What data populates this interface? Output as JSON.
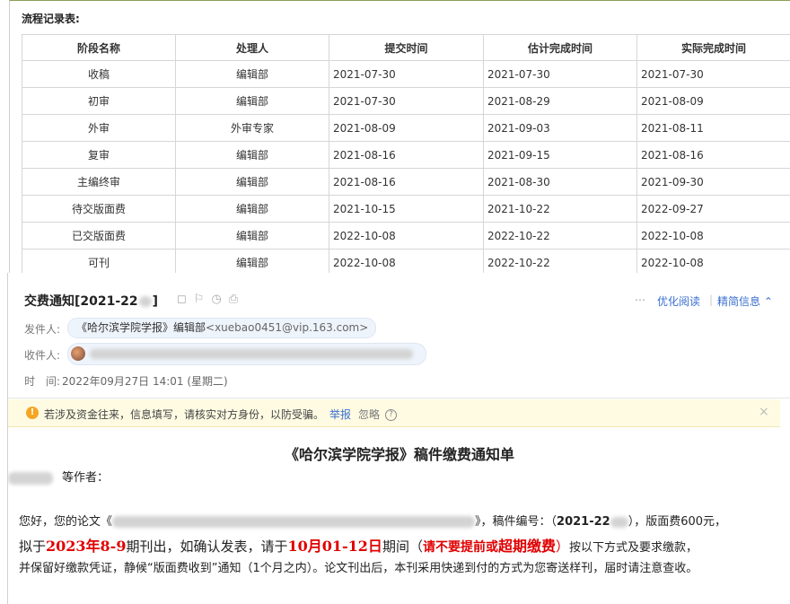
{
  "flow_record": {
    "title": "流程记录表:",
    "headers": [
      "阶段名称",
      "处理人",
      "提交时间",
      "估计完成时间",
      "实际完成时间"
    ],
    "rows": [
      [
        "收稿",
        "编辑部",
        "2021-07-30",
        "2021-07-30",
        "2021-07-30"
      ],
      [
        "初审",
        "编辑部",
        "2021-07-30",
        "2021-08-29",
        "2021-08-09"
      ],
      [
        "外审",
        "外审专家",
        "2021-08-09",
        "2021-09-03",
        "2021-08-11"
      ],
      [
        "复审",
        "编辑部",
        "2021-08-16",
        "2021-09-15",
        "2021-08-16"
      ],
      [
        "主编终审",
        "编辑部",
        "2021-08-16",
        "2021-08-30",
        "2021-09-30"
      ],
      [
        "待交版面费",
        "编辑部",
        "2021-10-15",
        "2021-10-22",
        "2022-09-27"
      ],
      [
        "已交版面费",
        "编辑部",
        "2022-10-08",
        "2022-10-22",
        "2022-10-08"
      ],
      [
        "可刊",
        "编辑部",
        "2022-10-08",
        "2022-10-22",
        "2022-10-08"
      ]
    ]
  },
  "email": {
    "subject_prefix": "交费通知[2021-22",
    "subject_suffix": "]",
    "optimize_read": "优化阅读",
    "simplified": "精简信息",
    "sender_label": "发件人:",
    "sender_name": "《哈尔滨学院学报》编辑部",
    "sender_addr": "<xuebao0451@vip.163.com>",
    "recipient_label": "收件人:",
    "time_label": "时　间:",
    "time_value": "2022年09月27日 14:01 (星期二)",
    "warning": "若涉及资金往来，信息填写，请核实对方身份，以防受骗。",
    "report": "举报",
    "ignore": "忽略",
    "doc_title": "《哈尔滨学院学报》稿件缴费通知单",
    "authors_suffix": "等作者：",
    "line1_a": "您好，您的论文《",
    "line1_b": "》，稿件编号：（",
    "line1_id": "2021-22",
    "line1_c": "），版面费600元，",
    "line2_a": "拟于",
    "line2_b": "2023年8-9",
    "line2_c": "期刊出，如确认发表，请于",
    "line2_d": "10月01-12日",
    "line2_e": "期间（",
    "line2_f": "请不要提前或",
    "line2_g": "超期缴费",
    "line2_h": "）",
    "line2_i": "按以下方式及要求缴款，",
    "line3": "并保留好缴款凭证，静候“版面费收到”通知（1个月之内）。论文刊出后，本刊采用快递到付的方式为您寄送样刊，届时请注意查收。"
  }
}
